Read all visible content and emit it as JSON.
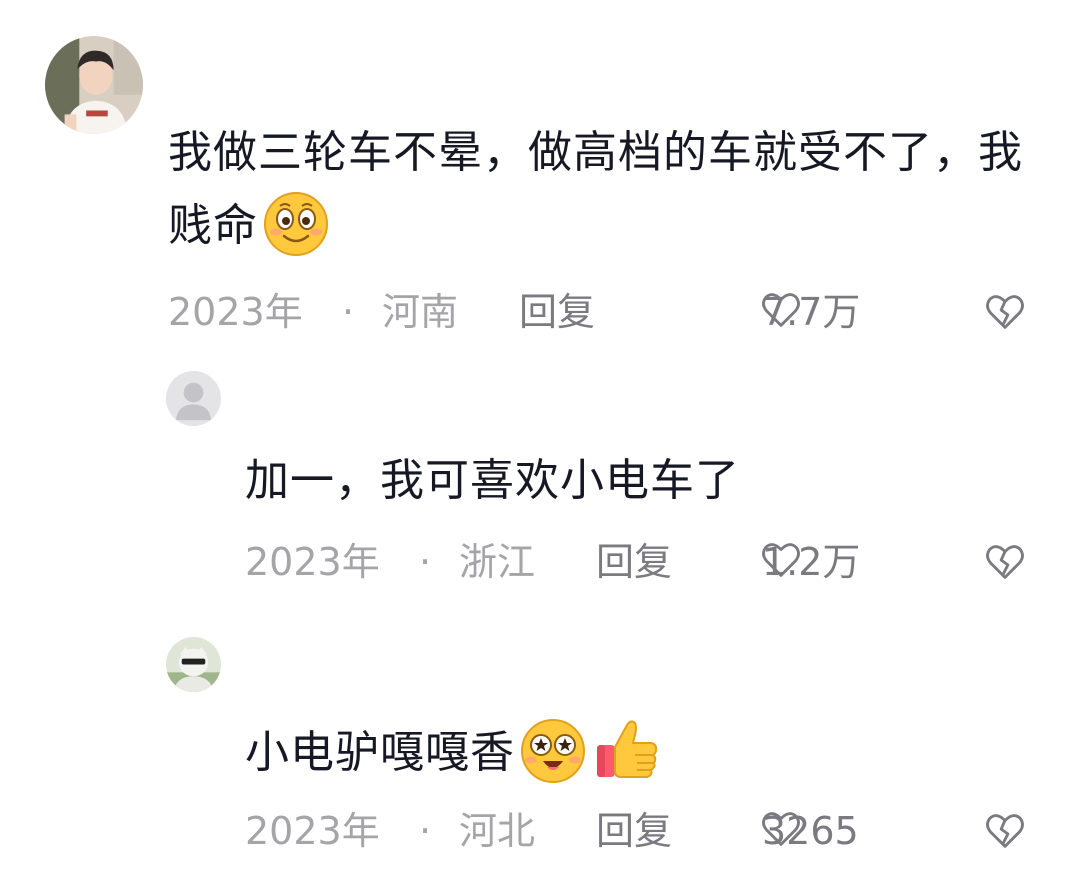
{
  "comments": [
    {
      "text": "我做三轮车不晕，做高档的车就受不了，我贱命",
      "emoji": [
        "smile-emoji"
      ],
      "year": "2023年",
      "separator": "·",
      "location": "河南",
      "reply_label": "回复",
      "likes": "7.7万"
    },
    {
      "text": "加一，我可喜欢小电车了",
      "emoji": [],
      "year": "2023年",
      "separator": "·",
      "location": "浙江",
      "reply_label": "回复",
      "likes": "1.2万"
    },
    {
      "text": "小电驴嘎嘎香",
      "emoji": [
        "star-eyes-emoji",
        "thumbs-up-emoji"
      ],
      "year": "2023年",
      "separator": "·",
      "location": "河北",
      "reply_label": "回复",
      "likes": "3265"
    }
  ],
  "icons": {
    "like": "heart-outline-icon",
    "dislike": "broken-heart-icon"
  },
  "colors": {
    "text": "#161823",
    "meta": "#a5a5a8",
    "action": "#7a7a80",
    "emoji_face": "#ffc83d"
  }
}
